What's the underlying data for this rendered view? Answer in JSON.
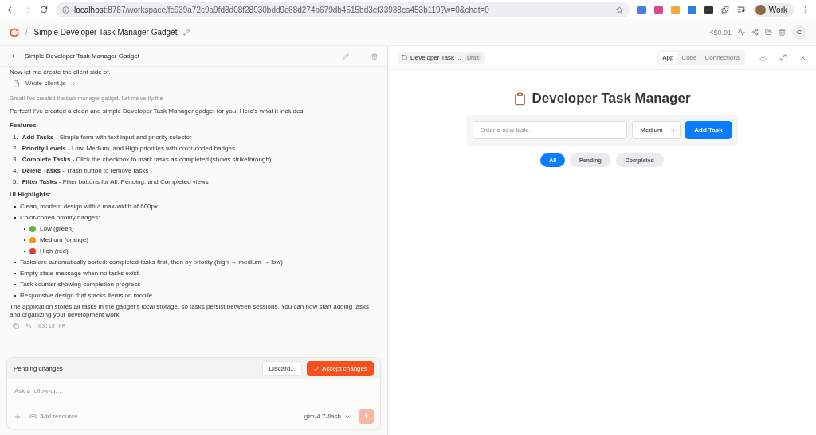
{
  "browser": {
    "url_host": "localhost",
    "url_rest": ":8787/workspace/fc939a72c9a9fd8d08f28930bdd9c68d274b679db4515bd3ef33938ca453b119?w=0&chat=0",
    "profile": "Work"
  },
  "app_header": {
    "separator": "/",
    "title": "Simple Developer Task Manager Gadget",
    "cost": "<$0.01",
    "avatar": "C"
  },
  "chat": {
    "title": "Simple Developer Task Manager Gadget",
    "cut_line": "Now let me create the client side of.",
    "file_step": "Wrote client.js",
    "status_line": "Great! I've created the task manager gadget. Let me verify the",
    "intro": "Perfect! I've created a clean and simple Developer Task Manager gadget for you. Here's what it includes:",
    "features_heading": "Features:",
    "features": [
      {
        "number": "1.",
        "text": "**Add Tasks** - Simple form with text input and priority selector"
      },
      {
        "number": "2.",
        "text": "**Priority Levels** - Low, Medium, and High priorities with color-coded badges"
      },
      {
        "number": "3.",
        "text": "**Complete Tasks** - Click the checkbox to mark tasks as completed (shows strikethrough)"
      },
      {
        "number": "4.",
        "text": "**Delete Tasks** - Trash button to remove tasks"
      },
      {
        "number": "5.",
        "text": "**Filter Tasks** - Filter buttons for All, Pending, and Completed views"
      }
    ],
    "highlights_heading": "UI Highlights:",
    "highlights": [
      {
        "text": "Clean, modern design with a max-width of 600px"
      },
      {
        "text": "Color-coded priority badges:",
        "children": [
          {
            "text": "Low (green)",
            "color": "#6ab04c"
          },
          {
            "text": "Medium (orange)",
            "color": "#f7931e"
          },
          {
            "text": "High (red)",
            "color": "#e53935"
          }
        ]
      },
      {
        "text": "Tasks are automatically sorted: completed tasks first, then by priority (high → medium → low)"
      },
      {
        "text": "Empty state message when no tasks exist"
      },
      {
        "text": "Task counter showing completion progress"
      },
      {
        "text": "Responsive design that stacks items on mobile"
      }
    ],
    "closing": "The application stores all tasks in the gadget's local storage, so tasks persist between sessions. You can now start adding tasks and organizing your development work!",
    "time": "03:18 PM"
  },
  "composer": {
    "pending_label": "Pending changes",
    "discard": "Discard...",
    "accept": "Accept changes",
    "placeholder": "Ask a follow-up...",
    "add_resource": "Add resource",
    "model": "glm-4.7-flash"
  },
  "preview": {
    "tab_title": "Developer Task ...",
    "badge": "Draft",
    "views": [
      {
        "label": "App",
        "selected": true
      },
      {
        "label": "Code",
        "selected": false
      },
      {
        "label": "Connections",
        "selected": false
      }
    ],
    "heading": "Developer Task Manager",
    "task_placeholder": "Enter a new task...",
    "priority": "Medium",
    "add_button": "Add Task",
    "filters": [
      {
        "label": "All",
        "selected": true
      },
      {
        "label": "Pending",
        "selected": false
      },
      {
        "label": "Completed",
        "selected": false
      }
    ]
  }
}
